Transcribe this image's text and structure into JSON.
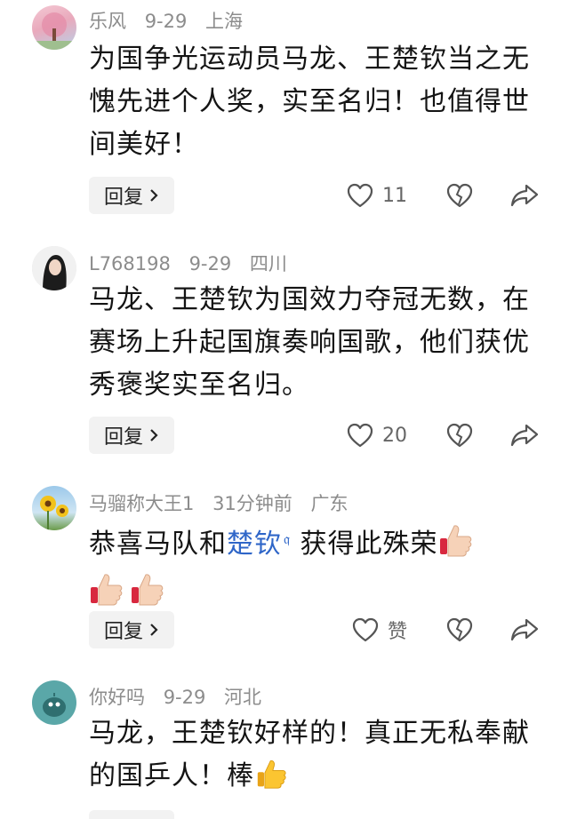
{
  "comments": [
    {
      "user": "乐风",
      "date": "9-29",
      "location": "上海",
      "text": "为国争光运动员马龙、王楚钦当之无愧先进个人奖，实至名归！也值得世间美好！",
      "reply_label": "回复",
      "likes": "11"
    },
    {
      "user": "L768198",
      "date": "9-29",
      "location": "四川",
      "text": "马龙、王楚钦为国效力夺冠无数，在赛场上升起国旗奏响国歌，他们获优秀褒奖实至名归。",
      "reply_label": "回复",
      "likes": "20"
    },
    {
      "user": "马骝称大王1",
      "date": "31分钟前",
      "location": "广东",
      "text_before": "恭喜马队和",
      "mention": "楚钦",
      "text_after": " 获得此殊荣",
      "reply_label": "回复",
      "likes": "赞"
    },
    {
      "user": "你好吗",
      "date": "9-29",
      "location": "河北",
      "text": "马龙，王楚钦好样的！真正无私奉献的国乒人！棒"
    }
  ],
  "icons": {
    "like": "heart-outline-icon",
    "dislike": "broken-heart-icon",
    "share": "share-arrow-icon",
    "thumb": "thumbs-up-emoji",
    "reply_chevron": "chevron-right-icon"
  }
}
